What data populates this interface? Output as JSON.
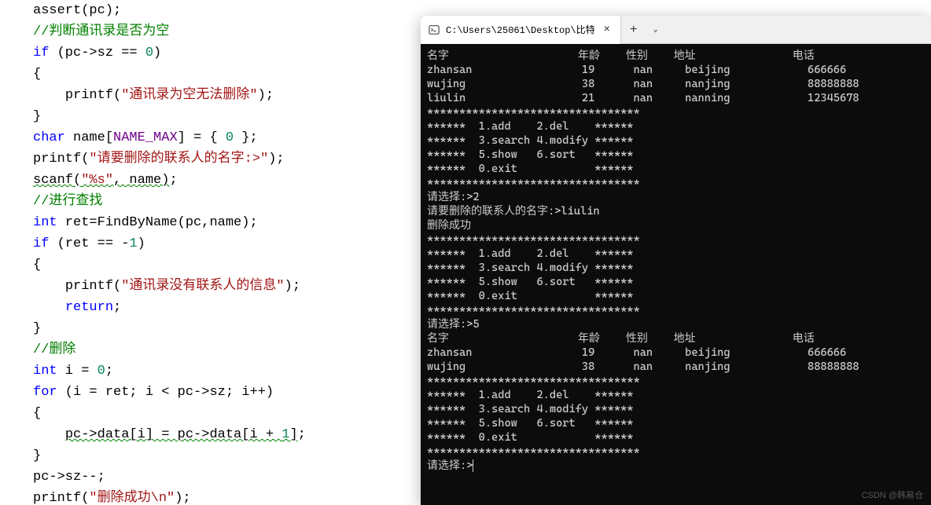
{
  "code": {
    "lines": [
      {
        "t": "assert(pc);",
        "cls": ""
      },
      {
        "t": "//判断通讯录是否为空",
        "cls": "comment"
      },
      {
        "t": "if (pc->sz == 0)",
        "cls": "if"
      },
      {
        "t": "{",
        "cls": ""
      },
      {
        "t": "    printf(\"通讯录为空无法删除\");",
        "cls": "printf"
      },
      {
        "t": "}",
        "cls": ""
      },
      {
        "t": "char name[NAME_MAX] = { 0 };",
        "cls": "decl"
      },
      {
        "t": "printf(\"请要删除的联系人的名字:>\");",
        "cls": "printf"
      },
      {
        "t": "scanf(\"%s\", name);",
        "cls": "scanf"
      },
      {
        "t": "//进行查找",
        "cls": "comment"
      },
      {
        "t": "int ret=FindByName(pc,name);",
        "cls": "decl2"
      },
      {
        "t": "if (ret == -1)",
        "cls": "if2"
      },
      {
        "t": "{",
        "cls": ""
      },
      {
        "t": "    printf(\"通讯录没有联系人的信息\");",
        "cls": "printf"
      },
      {
        "t": "    return;",
        "cls": "return"
      },
      {
        "t": "}",
        "cls": ""
      },
      {
        "t": "//删除",
        "cls": "comment"
      },
      {
        "t": "int i = 0;",
        "cls": "decl3"
      },
      {
        "t": "for (i = ret; i < pc->sz; i++)",
        "cls": "for"
      },
      {
        "t": "{",
        "cls": ""
      },
      {
        "t": "    pc->data[i] = pc->data[i + 1];",
        "cls": "assign"
      },
      {
        "t": "}",
        "cls": ""
      },
      {
        "t": "pc->sz--;",
        "cls": ""
      },
      {
        "t": "printf(\"删除成功\\n\");",
        "cls": "printf2"
      }
    ]
  },
  "terminal": {
    "tab_title": "C:\\Users\\25061\\Desktop\\比特",
    "output": [
      "名字                    年龄    性别    地址               电话",
      "zhansan                 19      nan     beijing            666666",
      "wujing                  38      nan     nanjing            88888888",
      "liulin                  21      nan     nanning            12345678",
      "*********************************",
      "******  1.add    2.del    ******",
      "******  3.search 4.modify ******",
      "******  5.show   6.sort   ******",
      "******  0.exit            ******",
      "*********************************",
      "请选择:>2",
      "请要删除的联系人的名字:>liulin",
      "删除成功",
      "*********************************",
      "******  1.add    2.del    ******",
      "******  3.search 4.modify ******",
      "******  5.show   6.sort   ******",
      "******  0.exit            ******",
      "*********************************",
      "请选择:>5",
      "名字                    年龄    性别    地址               电话",
      "zhansan                 19      nan     beijing            666666",
      "wujing                  38      nan     nanjing            88888888",
      "*********************************",
      "******  1.add    2.del    ******",
      "******  3.search 4.modify ******",
      "******  5.show   6.sort   ******",
      "******  0.exit            ******",
      "*********************************",
      "请选择:>"
    ]
  },
  "watermark": "CSDN @韩易仓"
}
